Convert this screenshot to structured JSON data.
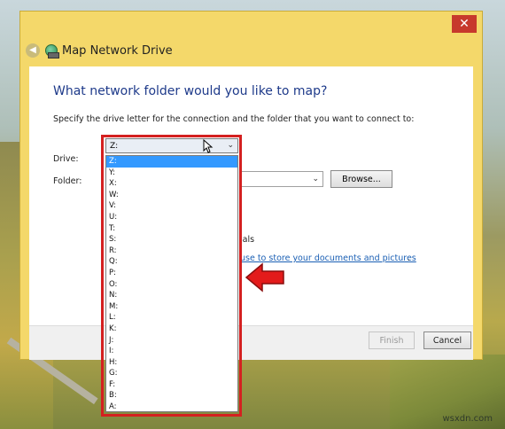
{
  "window": {
    "title": "Map Network Drive",
    "close_glyph": "✕"
  },
  "wizard": {
    "heading": "What network folder would you like to map?",
    "instruction": "Specify the drive letter for the connection and the folder that you want to connect to:",
    "drive_label": "Drive:",
    "drive_value": "Z:",
    "folder_label": "Folder:",
    "browse_label": "Browse...",
    "credentials_tail": "ials",
    "link_tail": " use to store your documents and pictures",
    "link_end": "."
  },
  "buttons": {
    "finish": "Finish",
    "cancel": "Cancel"
  },
  "drive_dropdown": {
    "selected": "Z:",
    "options": [
      "Z:",
      "Y:",
      "X:",
      "W:",
      "V:",
      "U:",
      "T:",
      "S:",
      "R:",
      "Q:",
      "P:",
      "O:",
      "N:",
      "M:",
      "L:",
      "K:",
      "J:",
      "I:",
      "H:",
      "G:",
      "F:",
      "B:",
      "A:"
    ]
  },
  "watermark": "wsxdn.com",
  "colors": {
    "title_bar": "#f4d86a",
    "heading": "#1e3a8a",
    "selection": "#3399ff",
    "highlight": "#d42020",
    "close": "#c7392c"
  }
}
